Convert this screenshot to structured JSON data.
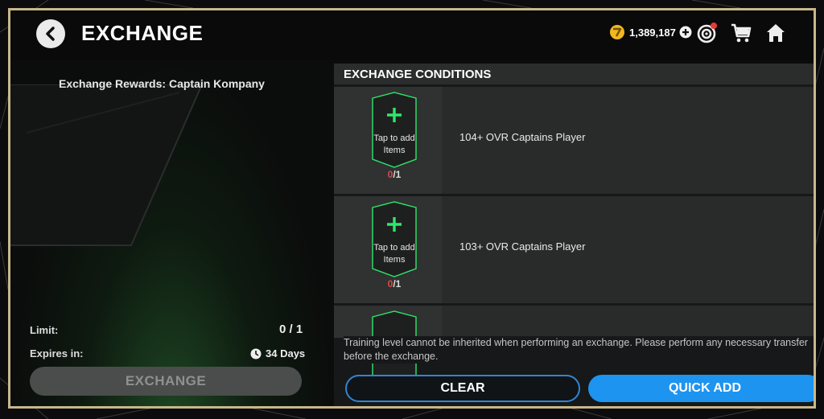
{
  "header": {
    "title": "EXCHANGE",
    "coins": "1,389,187",
    "icons": [
      "back-arrow-icon",
      "coin-icon",
      "plus-circle-icon",
      "target-icon",
      "cart-icon",
      "home-icon"
    ]
  },
  "reward": {
    "label": "Exchange Rewards:",
    "name": "Captain Kompany"
  },
  "limit": {
    "label": "Limit:",
    "value": "0 / 1"
  },
  "expires": {
    "label": "Expires in:",
    "value": "34 Days"
  },
  "exchange_button": "EXCHANGE",
  "conditions": {
    "header": "EXCHANGE CONDITIONS",
    "rows": [
      {
        "slot_text": "Tap to add Items",
        "have": "0",
        "need": "/1",
        "requirement": "104+ OVR Captains Player"
      },
      {
        "slot_text": "Tap to add Items",
        "have": "0",
        "need": "/1",
        "requirement": "103+ OVR Captains Player"
      }
    ]
  },
  "notice": "Training level cannot be inherited when performing an exchange. Please perform any necessary transfer before the exchange.",
  "buttons": {
    "clear": "CLEAR",
    "quick_add": "QUICK ADD"
  },
  "colors": {
    "frame": "#c7b88a",
    "accent_green": "#2ee86a",
    "accent_blue": "#1d94f0",
    "count_red": "#e04848",
    "coin_gold": "#f1b81f"
  }
}
